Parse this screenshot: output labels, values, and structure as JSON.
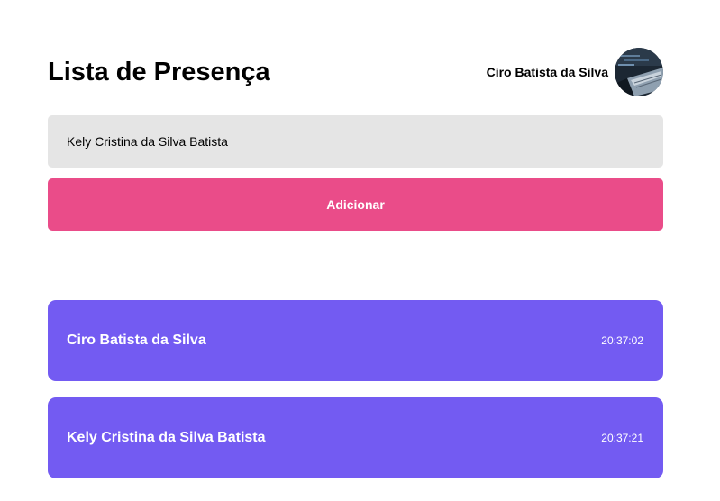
{
  "header": {
    "title": "Lista de Presença",
    "user_name": "Ciro Batista da Silva"
  },
  "form": {
    "input_value": "Kely Cristina da Silva Batista",
    "add_label": "Adicionar"
  },
  "attendees": [
    {
      "name": "Ciro Batista da Silva",
      "time": "20:37:02"
    },
    {
      "name": "Kely Cristina da Silva Batista",
      "time": "20:37:21"
    }
  ],
  "colors": {
    "accent_button": "#ea4c89",
    "card_background": "#735bf2",
    "input_background": "#e5e5e5"
  },
  "icons": {
    "avatar": "avatar-photo-laptop"
  }
}
